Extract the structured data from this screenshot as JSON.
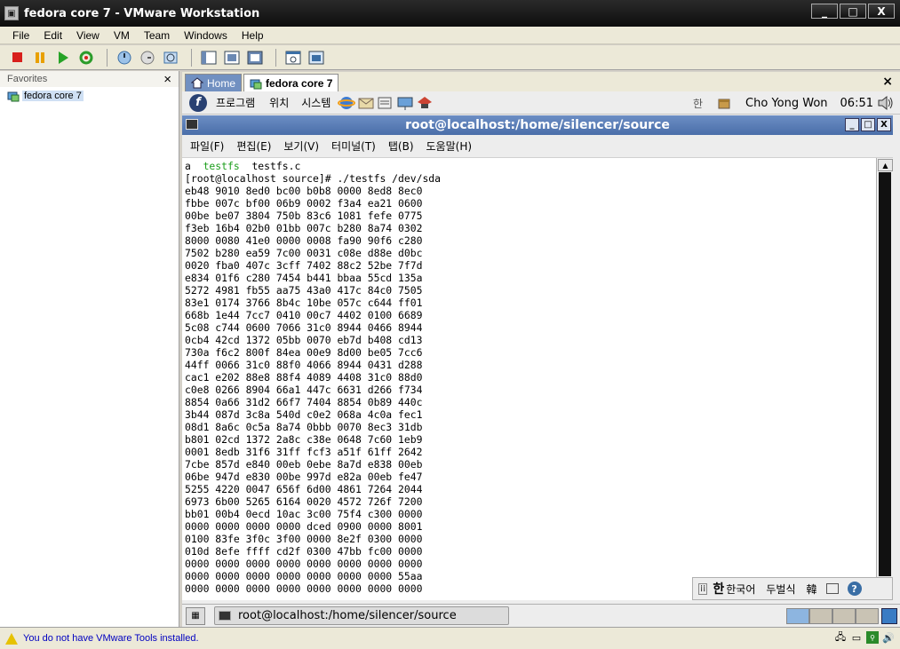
{
  "window": {
    "title": "fedora core 7 - VMware Workstation",
    "min": "_",
    "max": "□",
    "close": "X"
  },
  "menubar": [
    "File",
    "Edit",
    "View",
    "VM",
    "Team",
    "Windows",
    "Help"
  ],
  "sidebar": {
    "header": "Favorites",
    "close": "×",
    "items": [
      {
        "label": "fedora core 7"
      }
    ]
  },
  "tabs": [
    {
      "label": "Home"
    },
    {
      "label": "fedora core 7"
    }
  ],
  "tabs_close": "×",
  "gnome_panel": {
    "logo": "f",
    "menus": [
      "프로그램",
      "위치",
      "시스템"
    ],
    "lang": "한",
    "user": "Cho Yong Won",
    "time": "06:51"
  },
  "terminal": {
    "title": "root@localhost:/home/silencer/source",
    "btn_min": "_",
    "btn_max": "□",
    "btn_close": "X",
    "menus": [
      "파일(F)",
      "편집(E)",
      "보기(V)",
      "터미널(T)",
      "탭(B)",
      "도움말(H)"
    ],
    "ls_a": "a",
    "ls_testfs": "testfs",
    "ls_testfs_c": "testfs.c",
    "prompt": "[root@localhost source]# ./testfs /dev/sda",
    "hex": [
      "eb48 9010 8ed0 bc00 b0b8 0000 8ed8 8ec0",
      "fbbe 007c bf00 06b9 0002 f3a4 ea21 0600",
      "00be be07 3804 750b 83c6 1081 fefe 0775",
      "f3eb 16b4 02b0 01bb 007c b280 8a74 0302",
      "8000 0080 41e0 0000 0008 fa90 90f6 c280",
      "7502 b280 ea59 7c00 0031 c08e d88e d0bc",
      "0020 fba0 407c 3cff 7402 88c2 52be 7f7d",
      "e834 01f6 c280 7454 b441 bbaa 55cd 135a",
      "5272 4981 fb55 aa75 43a0 417c 84c0 7505",
      "83e1 0174 3766 8b4c 10be 057c c644 ff01",
      "668b 1e44 7cc7 0410 00c7 4402 0100 6689",
      "5c08 c744 0600 7066 31c0 8944 0466 8944",
      "0cb4 42cd 1372 05bb 0070 eb7d b408 cd13",
      "730a f6c2 800f 84ea 00e9 8d00 be05 7cc6",
      "44ff 0066 31c0 88f0 4066 8944 0431 d288",
      "cac1 e202 88e8 88f4 4089 4408 31c0 88d0",
      "c0e8 0266 8904 66a1 447c 6631 d266 f734",
      "8854 0a66 31d2 66f7 7404 8854 0b89 440c",
      "3b44 087d 3c8a 540d c0e2 068a 4c0a fec1",
      "08d1 8a6c 0c5a 8a74 0bbb 0070 8ec3 31db",
      "b801 02cd 1372 2a8c c38e 0648 7c60 1eb9",
      "0001 8edb 31f6 31ff fcf3 a51f 61ff 2642",
      "7cbe 857d e840 00eb 0ebe 8a7d e838 00eb",
      "06be 947d e830 00be 997d e82a 00eb fe47",
      "5255 4220 0047 656f 6d00 4861 7264 2044",
      "6973 6b00 5265 6164 0020 4572 726f 7200",
      "bb01 00b4 0ecd 10ac 3c00 75f4 c300 0000",
      "0000 0000 0000 0000 dced 0900 0000 8001",
      "0100 83fe 3f0c 3f00 0000 8e2f 0300 0000",
      "010d 8efe ffff cd2f 0300 47bb fc00 0000",
      "0000 0000 0000 0000 0000 0000 0000 0000",
      "0000 0000 0000 0000 0000 0000 0000 55aa",
      "0000 0000 0000 0000 0000 0000 0000 0000"
    ]
  },
  "ime": {
    "a": "한",
    "b": "한국어",
    "c": "두벌식",
    "d": "韓"
  },
  "taskbar": {
    "task": "root@localhost:/home/silencer/source"
  },
  "statusbar": {
    "message": "You do not have VMware Tools installed."
  }
}
